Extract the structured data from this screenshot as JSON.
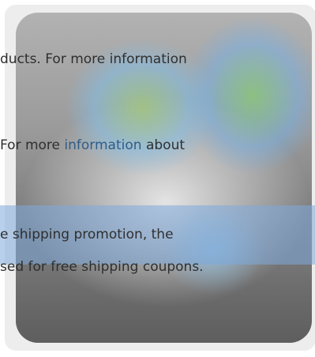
{
  "text": {
    "line1": "ducts. For more information",
    "line2_prefix": "For more",
    "line2_link": "information",
    "line2_suffix": "about",
    "line3": "e shipping promotion, the",
    "line4": "sed for free shipping coupons."
  },
  "colors": {
    "frame_bg": "#ededed",
    "text": "#2f2f2f",
    "link": "#2f5d8a",
    "highlight": "#7daadc"
  },
  "icons": {
    "artwork": "browser-globe-icon"
  }
}
